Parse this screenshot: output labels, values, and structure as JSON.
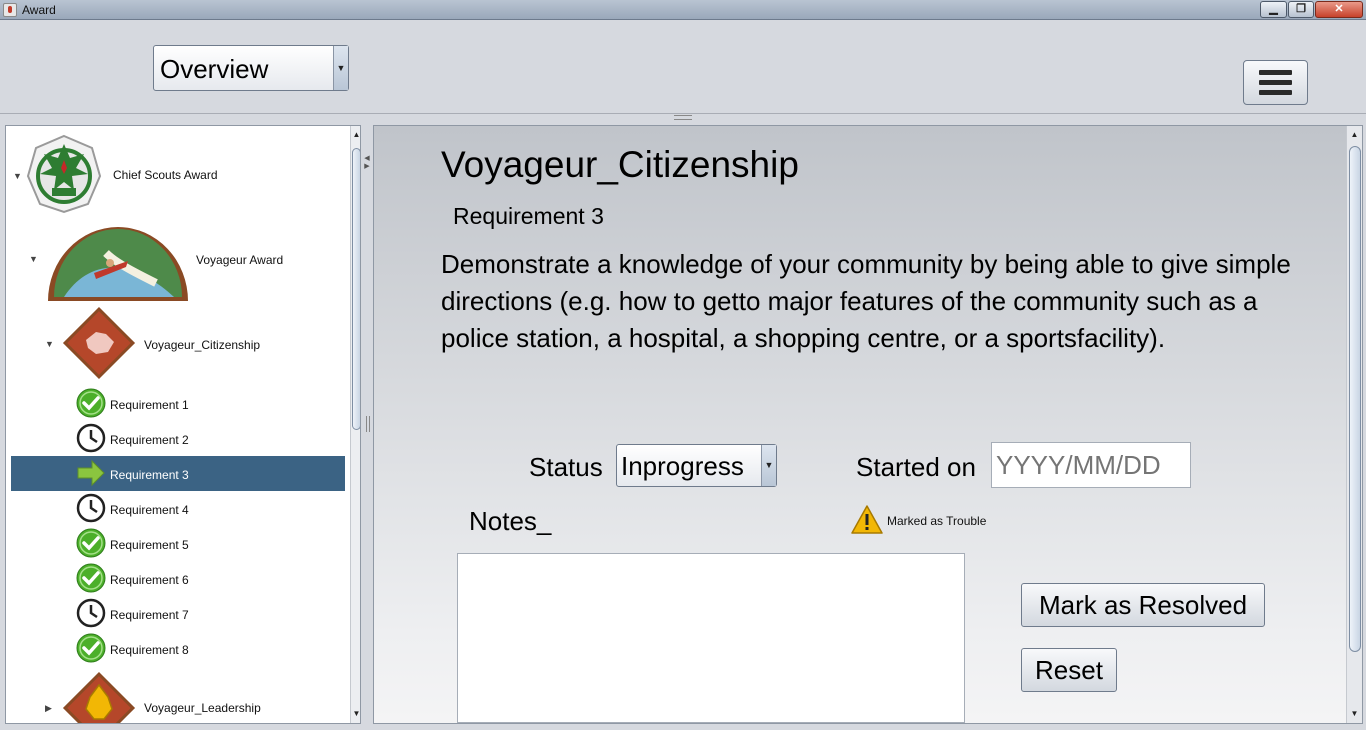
{
  "window": {
    "title": "Award"
  },
  "toolbar": {
    "view_selected": "Overview"
  },
  "tree": {
    "items": [
      {
        "label": "Chief Scouts Award",
        "expanded": true,
        "icon": "chief-scouts-award-badge-icon"
      },
      {
        "label": "Voyageur Award",
        "expanded": true,
        "icon": "voyageur-award-badge-icon"
      },
      {
        "label": "Voyageur_Citizenship",
        "expanded": true,
        "icon": "citizenship-badge-icon"
      },
      {
        "label": "Requirement 1",
        "status": "complete",
        "icon": "check-circle-icon"
      },
      {
        "label": "Requirement 2",
        "status": "pending",
        "icon": "clock-icon"
      },
      {
        "label": "Requirement 3",
        "status": "current",
        "icon": "arrow-right-icon",
        "selected": true
      },
      {
        "label": "Requirement 4",
        "status": "pending",
        "icon": "clock-icon"
      },
      {
        "label": "Requirement 5",
        "status": "complete",
        "icon": "check-circle-icon"
      },
      {
        "label": "Requirement 6",
        "status": "complete",
        "icon": "check-circle-icon"
      },
      {
        "label": "Requirement 7",
        "status": "pending",
        "icon": "clock-icon"
      },
      {
        "label": "Requirement 8",
        "status": "complete",
        "icon": "check-circle-icon"
      },
      {
        "label": "Voyageur_Leadership",
        "expanded": false,
        "icon": "leadership-badge-icon"
      }
    ]
  },
  "detail": {
    "title": "Voyageur_Citizenship",
    "subtitle": "Requirement 3",
    "description": "Demonstrate a knowledge of your community by being able to give simple directions (e.g. how to getto major features of the community such as a police station, a hospital, a shopping centre, or a sportsfacility).",
    "status_label": "Status",
    "status_value": "Inprogress",
    "started_label": "Started on",
    "started_placeholder": "YYYY/MM/DD",
    "trouble_text": "Marked as Trouble",
    "notes_label": "Notes_",
    "resolve_label": "Mark as Resolved",
    "reset_label": "Reset"
  },
  "colors": {
    "selection": "#3b6384",
    "check_green": "#4caf2a",
    "arrow_green": "#8bc53f",
    "warning_yellow": "#f2b705"
  }
}
